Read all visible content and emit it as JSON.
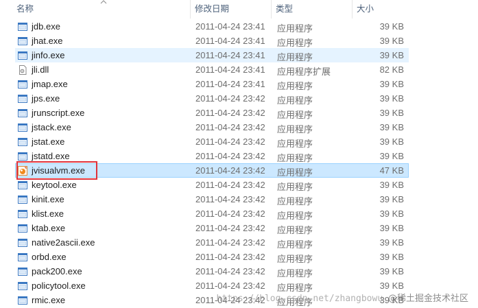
{
  "header": {
    "name": "名称",
    "date": "修改日期",
    "type": "类型",
    "size": "大小"
  },
  "files": [
    {
      "name": "jdb.exe",
      "date": "2011-04-24 23:41",
      "type": "应用程序",
      "size": "39 KB",
      "icon": "exe-icon"
    },
    {
      "name": "jhat.exe",
      "date": "2011-04-24 23:41",
      "type": "应用程序",
      "size": "39 KB",
      "icon": "exe-icon"
    },
    {
      "name": "jinfo.exe",
      "date": "2011-04-24 23:41",
      "type": "应用程序",
      "size": "39 KB",
      "icon": "exe-icon"
    },
    {
      "name": "jli.dll",
      "date": "2011-04-24 23:41",
      "type": "应用程序扩展",
      "size": "82 KB",
      "icon": "dll-icon"
    },
    {
      "name": "jmap.exe",
      "date": "2011-04-24 23:41",
      "type": "应用程序",
      "size": "39 KB",
      "icon": "exe-icon"
    },
    {
      "name": "jps.exe",
      "date": "2011-04-24 23:42",
      "type": "应用程序",
      "size": "39 KB",
      "icon": "exe-icon"
    },
    {
      "name": "jrunscript.exe",
      "date": "2011-04-24 23:42",
      "type": "应用程序",
      "size": "39 KB",
      "icon": "exe-icon"
    },
    {
      "name": "jstack.exe",
      "date": "2011-04-24 23:42",
      "type": "应用程序",
      "size": "39 KB",
      "icon": "exe-icon"
    },
    {
      "name": "jstat.exe",
      "date": "2011-04-24 23:42",
      "type": "应用程序",
      "size": "39 KB",
      "icon": "exe-icon"
    },
    {
      "name": "jstatd.exe",
      "date": "2011-04-24 23:42",
      "type": "应用程序",
      "size": "39 KB",
      "icon": "exe-icon"
    },
    {
      "name": "jvisualvm.exe",
      "date": "2011-04-24 23:42",
      "type": "应用程序",
      "size": "47 KB",
      "icon": "jvisualvm-icon"
    },
    {
      "name": "keytool.exe",
      "date": "2011-04-24 23:42",
      "type": "应用程序",
      "size": "39 KB",
      "icon": "exe-icon"
    },
    {
      "name": "kinit.exe",
      "date": "2011-04-24 23:42",
      "type": "应用程序",
      "size": "39 KB",
      "icon": "exe-icon"
    },
    {
      "name": "klist.exe",
      "date": "2011-04-24 23:42",
      "type": "应用程序",
      "size": "39 KB",
      "icon": "exe-icon"
    },
    {
      "name": "ktab.exe",
      "date": "2011-04-24 23:42",
      "type": "应用程序",
      "size": "39 KB",
      "icon": "exe-icon"
    },
    {
      "name": "native2ascii.exe",
      "date": "2011-04-24 23:42",
      "type": "应用程序",
      "size": "39 KB",
      "icon": "exe-icon"
    },
    {
      "name": "orbd.exe",
      "date": "2011-04-24 23:42",
      "type": "应用程序",
      "size": "39 KB",
      "icon": "exe-icon"
    },
    {
      "name": "pack200.exe",
      "date": "2011-04-24 23:42",
      "type": "应用程序",
      "size": "39 KB",
      "icon": "exe-icon"
    },
    {
      "name": "policytool.exe",
      "date": "2011-04-24 23:42",
      "type": "应用程序",
      "size": "39 KB",
      "icon": "exe-icon"
    },
    {
      "name": "rmic.exe",
      "date": "2011-04-24 23:42",
      "type": "应用程序",
      "size": "39 KB",
      "icon": "exe-icon"
    }
  ],
  "hover_row": "jinfo.exe",
  "selected_row": "jvisualvm.exe",
  "annotation_color": "#e0323a",
  "selection_color": "#cce8ff",
  "hover_color": "#e5f3ff",
  "watermark": {
    "url": "https://blog.csdn.net/zhangbowu",
    "brand": "@稀土掘金技术社区"
  }
}
